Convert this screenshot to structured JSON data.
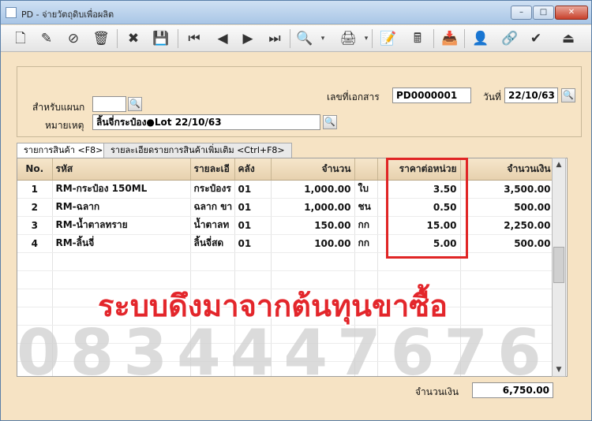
{
  "window": {
    "title": "PD - จ่ายวัตถุดิบเพื่อผลิต",
    "minimize": "–",
    "maximize": "□",
    "close": "✕"
  },
  "toolbar": [
    {
      "name": "new-doc-icon",
      "glyph": "🗋"
    },
    {
      "name": "edit-icon",
      "glyph": "✎"
    },
    {
      "name": "void-icon",
      "glyph": "⊘"
    },
    {
      "name": "trash-icon",
      "glyph": "🗑"
    },
    {
      "name": "cancel-icon",
      "glyph": "✖"
    },
    {
      "name": "save-icon",
      "glyph": "💾"
    },
    {
      "name": "first-record-icon",
      "glyph": "⏮"
    },
    {
      "name": "prev-record-icon",
      "glyph": "◀"
    },
    {
      "name": "next-record-icon",
      "glyph": "▶"
    },
    {
      "name": "last-record-icon",
      "glyph": "⏭"
    },
    {
      "name": "search-doc-icon",
      "glyph": "🔍"
    },
    {
      "name": "search-dropdown-icon",
      "glyph": "▾"
    },
    {
      "name": "print-icon",
      "glyph": "🖨"
    },
    {
      "name": "print-dropdown-icon",
      "glyph": "▾"
    },
    {
      "name": "note-icon",
      "glyph": "📝"
    },
    {
      "name": "calculator-icon",
      "glyph": "🖩"
    },
    {
      "name": "import-icon",
      "glyph": "📥"
    },
    {
      "name": "approve-user-icon",
      "glyph": "👤"
    },
    {
      "name": "link-icon",
      "glyph": "🔗"
    },
    {
      "name": "approve-doc-icon",
      "glyph": "✔"
    },
    {
      "name": "exit-icon",
      "glyph": "⏏"
    }
  ],
  "header": {
    "doc_no_label": "เลขที่เอกสาร",
    "doc_no": "PD0000001",
    "date_label": "วันที่",
    "date": "22/10/63",
    "dept_label": "สำหรับแผนก",
    "dept": "",
    "remark_label": "หมายเหตุ",
    "remark": "ลิ้นจี่กระป๋อง●Lot 22/10/63"
  },
  "tabs": [
    {
      "label": "รายการสินค้า <F8>"
    },
    {
      "label": "รายละเอียดรายการสินค้าเพิ่มเติม <Ctrl+F8>"
    }
  ],
  "grid": {
    "columns": [
      "No.",
      "รหัส",
      "รายละเอี",
      "คลัง",
      "จำนวน",
      "",
      "ราคาต่อหน่วย",
      "จำนวนเงิน"
    ],
    "rows": [
      [
        "1",
        "RM-กระป๋อง 150ML",
        "กระป๋องร",
        "01",
        "1,000.00",
        "ใบ",
        "3.50",
        "3,500.00"
      ],
      [
        "2",
        "RM-ฉลาก",
        "ฉลาก ขา",
        "01",
        "1,000.00",
        "ชน",
        "0.50",
        "500.00"
      ],
      [
        "3",
        "RM-น้ำตาลทราย",
        "น้ำตาลท",
        "01",
        "150.00",
        "กก",
        "15.00",
        "2,250.00"
      ],
      [
        "4",
        "RM-ลิ้นจี่",
        "ลิ้นจี่สด",
        "01",
        "100.00",
        "กก",
        "5.00",
        "500.00"
      ]
    ],
    "empty_rows": 7
  },
  "scrollbar": {
    "up": "▲",
    "down": "▼"
  },
  "overlay_text": "ระบบดึงมาจากต้นทุนขาซื้อ",
  "watermark": "0834447676",
  "footer": {
    "total_label": "จำนวนเงิน",
    "total": "6,750.00"
  },
  "lookup_icon": "🔍"
}
